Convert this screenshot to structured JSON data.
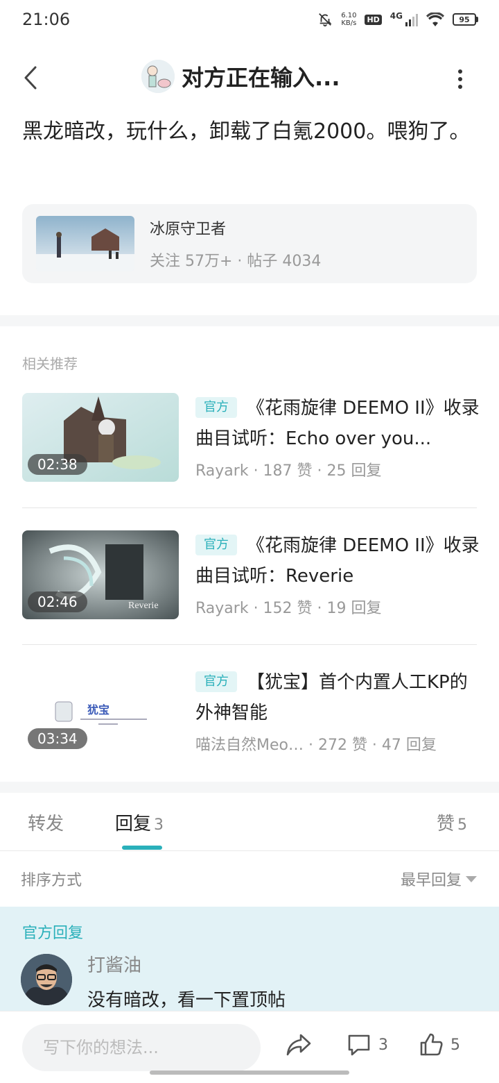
{
  "status_bar": {
    "time": "21:06",
    "net_speed_value": "6.10",
    "net_speed_unit": "KB/s",
    "hd": "HD",
    "network": "4G",
    "battery": "95"
  },
  "header": {
    "title": "对方正在输入..."
  },
  "post": {
    "text": "黑龙暗改，玩什么，卸载了白氪2000。喂狗了。"
  },
  "forum": {
    "name": "冰原守卫者",
    "stats": "关注 57万+ · 帖子 4034"
  },
  "recommendations": {
    "section_title": "相关推荐",
    "items": [
      {
        "duration": "02:38",
        "tag": "官方",
        "title": "《花雨旋律 DEEMO II》收录曲目试听：Echo over you...",
        "meta": "Rayark · 187 赞 · 25 回复"
      },
      {
        "duration": "02:46",
        "tag": "官方",
        "title": "《花雨旋律 DEEMO II》收录曲目试听：Reverie",
        "meta": "Rayark · 152 赞 · 19 回复",
        "thumb_text": "Reverie"
      },
      {
        "duration": "03:34",
        "tag": "官方",
        "title": "【犹宝】首个内置人工KP的外神智能",
        "meta": "喵法自然Meo… · 272 赞 · 47 回复",
        "thumb_text": "犹宝"
      }
    ]
  },
  "tabs": {
    "forward": "转发",
    "reply": "回复",
    "reply_count": "3",
    "like": "赞",
    "like_count": "5"
  },
  "sort": {
    "label": "排序方式",
    "value": "最早回复"
  },
  "official_reply": {
    "label": "官方回复",
    "author": "打酱油",
    "text": "没有暗改，看一下置顶帖"
  },
  "bottom_bar": {
    "placeholder": "写下你的想法...",
    "comment_count": "3",
    "like_count": "5"
  }
}
